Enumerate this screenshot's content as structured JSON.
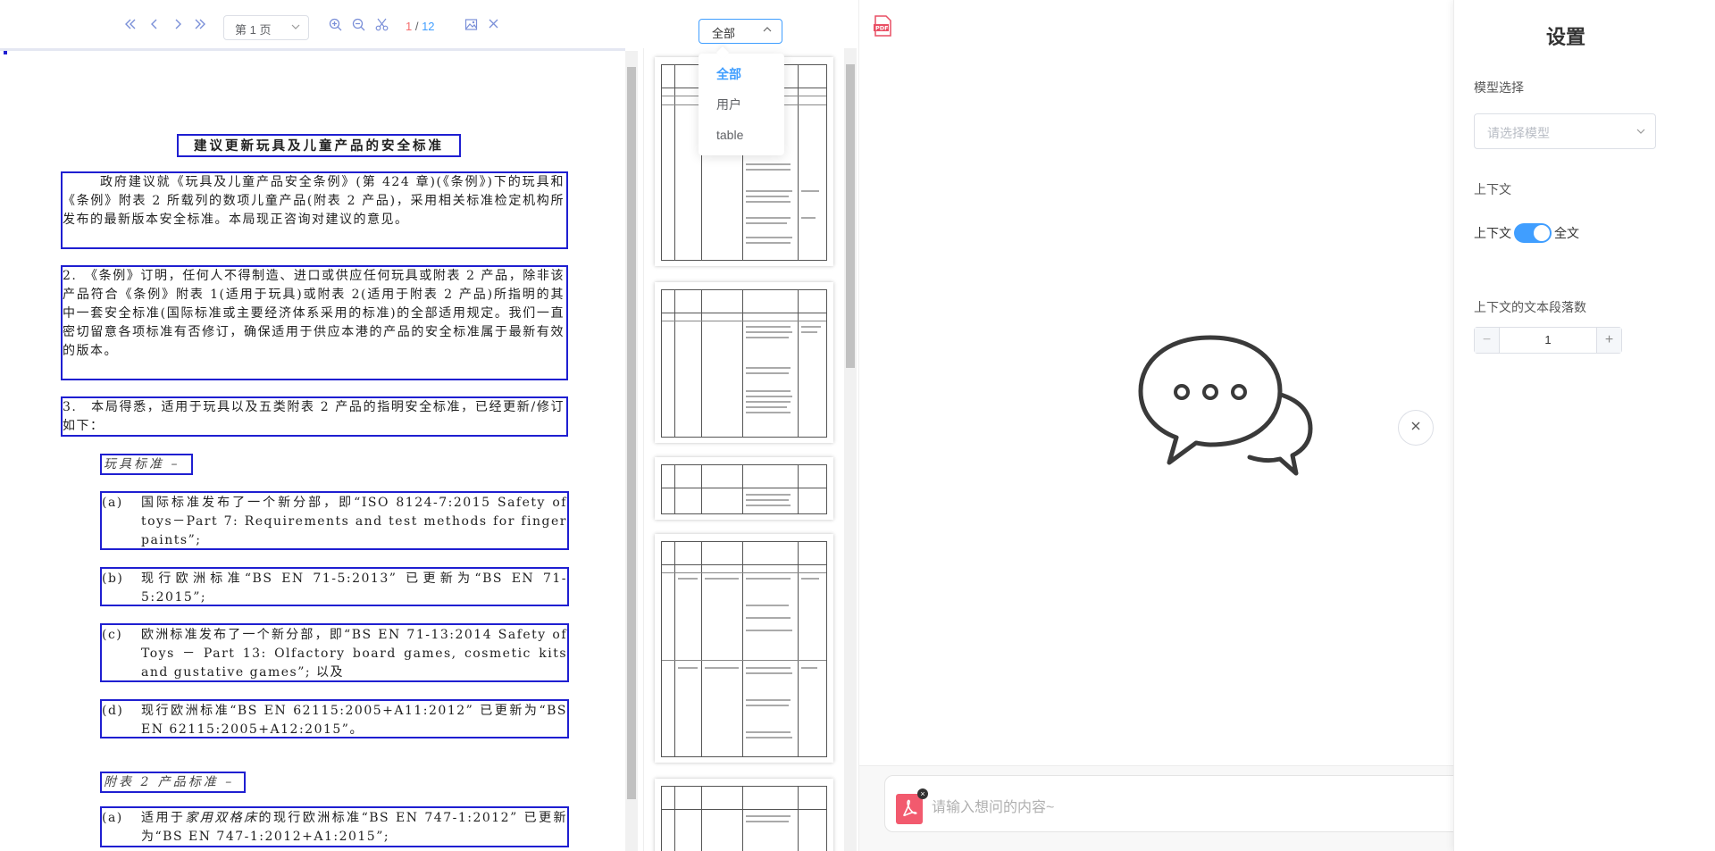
{
  "toolbar": {
    "page_select": "第 1 页",
    "page_current": "1",
    "page_sep": " / ",
    "page_total": "12",
    "filter_value": "全部",
    "filter_options": [
      "全部",
      "用户",
      "table"
    ]
  },
  "document": {
    "title": "建议更新玩具及儿童产品的安全标准",
    "p1": "政府建议就《玩具及儿童产品安全条例》(第 424 章)(《条例》)下的玩具和《条例》附表 2 所载列的数项儿童产品(附表 2 产品)，采用相关标准检定机构所发布的最新版本安全标准。本局现正咨询对建议的意见。",
    "p2": "2.　《条例》订明，任何人不得制造、进口或供应任何玩具或附表 2 产品，除非该产品符合《条例》附表 1(适用于玩具)或附表 2(适用于附表 2 产品)所指明的其中一套安全标准(国际标准或主要经济体系采用的标准)的全部适用规定。我们一直密切留意各项标准有否修订，确保适用于供应本港的产品的安全标准属于最新有效的版本。",
    "p3": "3.　本局得悉，适用于玩具以及五类附表 2 产品的指明安全标准，已经更新/修订如下：",
    "toy_heading": "玩具标准 –",
    "items": [
      {
        "label": "(a)",
        "text": "国际标准发布了一个新分部，即“ISO 8124-7:2015 Safety of toys－Part 7: Requirements and test methods for finger paints”;"
      },
      {
        "label": "(b)",
        "text": "现行欧洲标准“BS EN 71-5:2013” 已更新为“BS EN 71-5:2015”;"
      },
      {
        "label": "(c)",
        "text": "欧洲标准发布了一个新分部，即“BS EN 71-13:2014 Safety of Toys － Part 13: Olfactory board games, cosmetic kits and gustative games”; 以及"
      },
      {
        "label": "(d)",
        "text": "现行欧洲标准“BS EN 62115:2005+A11:2012” 已更新为“BS EN 62115:2005+A12:2015”。"
      }
    ],
    "schedule_heading": "附表 2 产品标准 –",
    "item_e": {
      "label": "(a)",
      "text_a": "适用于",
      "text_em": "家用双格床",
      "text_b": "的现行欧洲标准“BS EN 747-1:2012” 已更新为“BS EN 747-1:2012+A1:2015”;"
    }
  },
  "chat": {
    "input_placeholder": "请输入想问的内容~"
  },
  "settings": {
    "title": "设置",
    "model_label": "模型选择",
    "model_placeholder": "请选择模型",
    "context_label": "上下文",
    "switch_left": "上下文",
    "switch_right": "全文",
    "paragraph_label": "上下文的文本段落数",
    "paragraph_value": "1"
  },
  "colors": {
    "accent": "#409eff",
    "highlight_box": "#1f1fd1",
    "pdf_red": "#f25a6e"
  }
}
